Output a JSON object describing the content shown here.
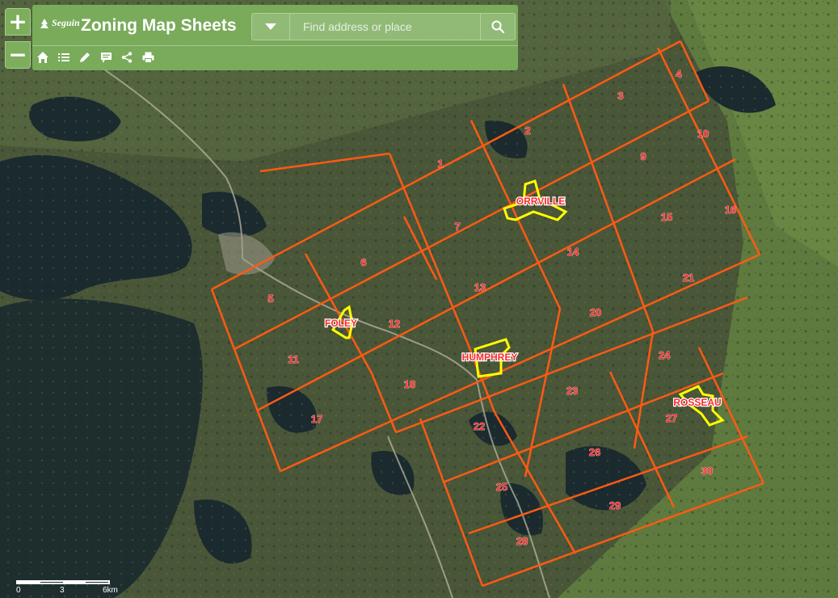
{
  "app": {
    "title": "Zoning Map Sheets",
    "logo_text": "Seguin"
  },
  "zoom": {
    "in_label": "+",
    "out_label": "−"
  },
  "search": {
    "placeholder": "Find address or place"
  },
  "toolbar": {
    "icons": [
      "home-icon",
      "list-icon",
      "pencil-icon",
      "comment-icon",
      "share-icon",
      "print-icon"
    ]
  },
  "scale": {
    "labels": [
      "0",
      "3",
      "6km"
    ]
  },
  "colors": {
    "accent": "#7cb05c",
    "grid": "#ff5a14",
    "settlement": "#ffff00",
    "label": "#ff2828"
  },
  "sheets": [
    "1",
    "2",
    "3",
    "4",
    "5",
    "6",
    "7",
    "9",
    "10",
    "11",
    "12",
    "13",
    "14",
    "15",
    "16",
    "17",
    "18",
    "20",
    "21",
    "22",
    "23",
    "24",
    "25",
    "26",
    "27",
    "28",
    "29",
    "30"
  ],
  "settlements": [
    "ORRVILLE",
    "FOLEY",
    "HUMPHREY",
    "ROSSEAU"
  ]
}
